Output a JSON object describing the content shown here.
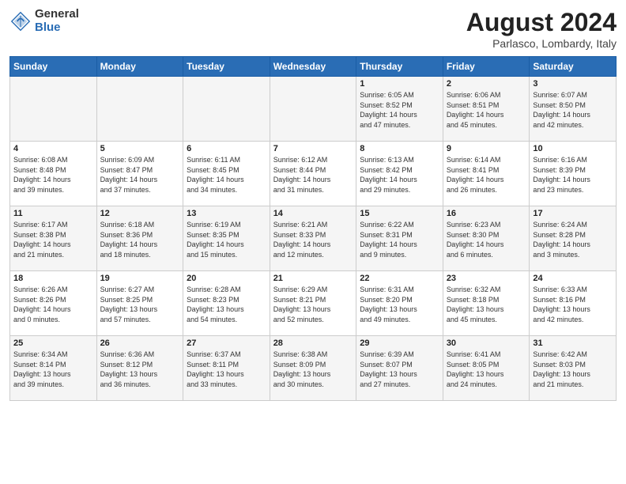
{
  "header": {
    "logo_general": "General",
    "logo_blue": "Blue",
    "main_title": "August 2024",
    "subtitle": "Parlasco, Lombardy, Italy"
  },
  "weekdays": [
    "Sunday",
    "Monday",
    "Tuesday",
    "Wednesday",
    "Thursday",
    "Friday",
    "Saturday"
  ],
  "weeks": [
    [
      {
        "day": "",
        "info": ""
      },
      {
        "day": "",
        "info": ""
      },
      {
        "day": "",
        "info": ""
      },
      {
        "day": "",
        "info": ""
      },
      {
        "day": "1",
        "info": "Sunrise: 6:05 AM\nSunset: 8:52 PM\nDaylight: 14 hours\nand 47 minutes."
      },
      {
        "day": "2",
        "info": "Sunrise: 6:06 AM\nSunset: 8:51 PM\nDaylight: 14 hours\nand 45 minutes."
      },
      {
        "day": "3",
        "info": "Sunrise: 6:07 AM\nSunset: 8:50 PM\nDaylight: 14 hours\nand 42 minutes."
      }
    ],
    [
      {
        "day": "4",
        "info": "Sunrise: 6:08 AM\nSunset: 8:48 PM\nDaylight: 14 hours\nand 39 minutes."
      },
      {
        "day": "5",
        "info": "Sunrise: 6:09 AM\nSunset: 8:47 PM\nDaylight: 14 hours\nand 37 minutes."
      },
      {
        "day": "6",
        "info": "Sunrise: 6:11 AM\nSunset: 8:45 PM\nDaylight: 14 hours\nand 34 minutes."
      },
      {
        "day": "7",
        "info": "Sunrise: 6:12 AM\nSunset: 8:44 PM\nDaylight: 14 hours\nand 31 minutes."
      },
      {
        "day": "8",
        "info": "Sunrise: 6:13 AM\nSunset: 8:42 PM\nDaylight: 14 hours\nand 29 minutes."
      },
      {
        "day": "9",
        "info": "Sunrise: 6:14 AM\nSunset: 8:41 PM\nDaylight: 14 hours\nand 26 minutes."
      },
      {
        "day": "10",
        "info": "Sunrise: 6:16 AM\nSunset: 8:39 PM\nDaylight: 14 hours\nand 23 minutes."
      }
    ],
    [
      {
        "day": "11",
        "info": "Sunrise: 6:17 AM\nSunset: 8:38 PM\nDaylight: 14 hours\nand 21 minutes."
      },
      {
        "day": "12",
        "info": "Sunrise: 6:18 AM\nSunset: 8:36 PM\nDaylight: 14 hours\nand 18 minutes."
      },
      {
        "day": "13",
        "info": "Sunrise: 6:19 AM\nSunset: 8:35 PM\nDaylight: 14 hours\nand 15 minutes."
      },
      {
        "day": "14",
        "info": "Sunrise: 6:21 AM\nSunset: 8:33 PM\nDaylight: 14 hours\nand 12 minutes."
      },
      {
        "day": "15",
        "info": "Sunrise: 6:22 AM\nSunset: 8:31 PM\nDaylight: 14 hours\nand 9 minutes."
      },
      {
        "day": "16",
        "info": "Sunrise: 6:23 AM\nSunset: 8:30 PM\nDaylight: 14 hours\nand 6 minutes."
      },
      {
        "day": "17",
        "info": "Sunrise: 6:24 AM\nSunset: 8:28 PM\nDaylight: 14 hours\nand 3 minutes."
      }
    ],
    [
      {
        "day": "18",
        "info": "Sunrise: 6:26 AM\nSunset: 8:26 PM\nDaylight: 14 hours\nand 0 minutes."
      },
      {
        "day": "19",
        "info": "Sunrise: 6:27 AM\nSunset: 8:25 PM\nDaylight: 13 hours\nand 57 minutes."
      },
      {
        "day": "20",
        "info": "Sunrise: 6:28 AM\nSunset: 8:23 PM\nDaylight: 13 hours\nand 54 minutes."
      },
      {
        "day": "21",
        "info": "Sunrise: 6:29 AM\nSunset: 8:21 PM\nDaylight: 13 hours\nand 52 minutes."
      },
      {
        "day": "22",
        "info": "Sunrise: 6:31 AM\nSunset: 8:20 PM\nDaylight: 13 hours\nand 49 minutes."
      },
      {
        "day": "23",
        "info": "Sunrise: 6:32 AM\nSunset: 8:18 PM\nDaylight: 13 hours\nand 45 minutes."
      },
      {
        "day": "24",
        "info": "Sunrise: 6:33 AM\nSunset: 8:16 PM\nDaylight: 13 hours\nand 42 minutes."
      }
    ],
    [
      {
        "day": "25",
        "info": "Sunrise: 6:34 AM\nSunset: 8:14 PM\nDaylight: 13 hours\nand 39 minutes."
      },
      {
        "day": "26",
        "info": "Sunrise: 6:36 AM\nSunset: 8:12 PM\nDaylight: 13 hours\nand 36 minutes."
      },
      {
        "day": "27",
        "info": "Sunrise: 6:37 AM\nSunset: 8:11 PM\nDaylight: 13 hours\nand 33 minutes."
      },
      {
        "day": "28",
        "info": "Sunrise: 6:38 AM\nSunset: 8:09 PM\nDaylight: 13 hours\nand 30 minutes."
      },
      {
        "day": "29",
        "info": "Sunrise: 6:39 AM\nSunset: 8:07 PM\nDaylight: 13 hours\nand 27 minutes."
      },
      {
        "day": "30",
        "info": "Sunrise: 6:41 AM\nSunset: 8:05 PM\nDaylight: 13 hours\nand 24 minutes."
      },
      {
        "day": "31",
        "info": "Sunrise: 6:42 AM\nSunset: 8:03 PM\nDaylight: 13 hours\nand 21 minutes."
      }
    ]
  ]
}
